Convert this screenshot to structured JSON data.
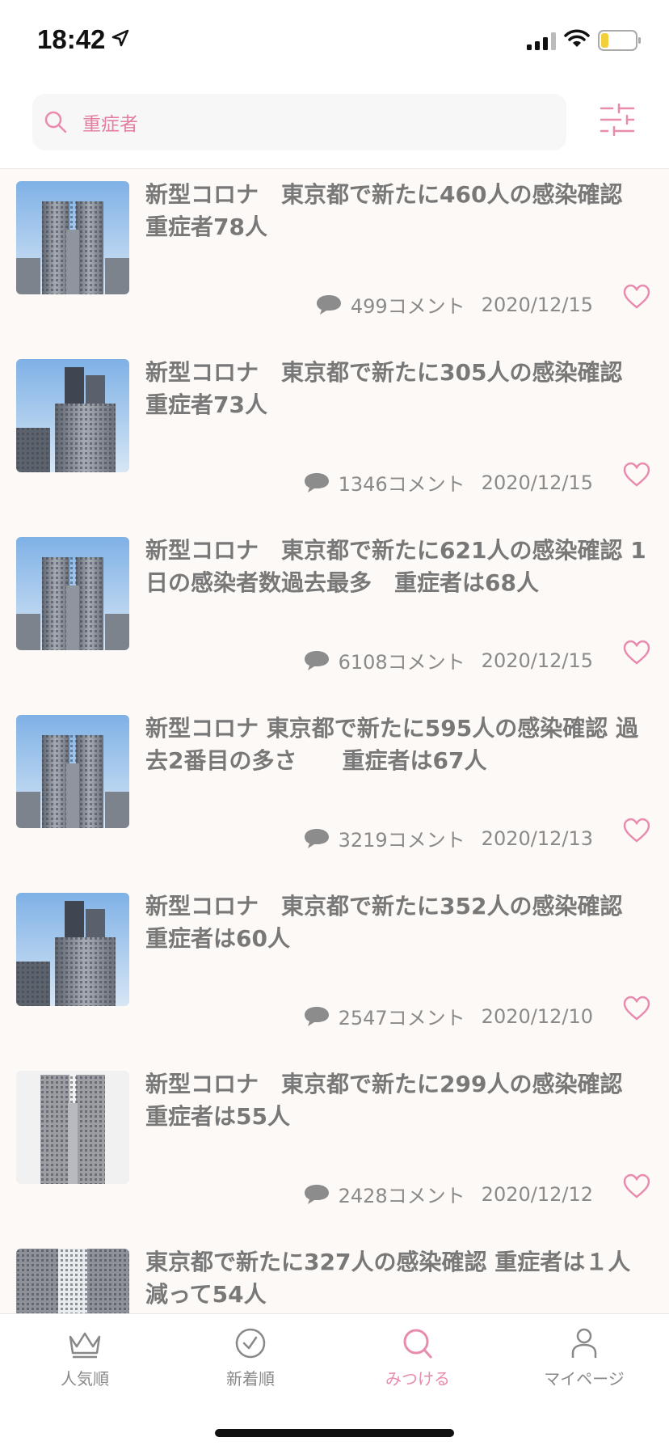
{
  "status_bar": {
    "time": "18:42"
  },
  "search": {
    "query": "重症者"
  },
  "articles": [
    {
      "title": "新型コロナ　東京都で新たに460人の感染確認 重症者78人",
      "comments": "499コメント",
      "date": "2020/12/15"
    },
    {
      "title": "新型コロナ　東京都で新たに305人の感染確認 重症者73人",
      "comments": "1346コメント",
      "date": "2020/12/15"
    },
    {
      "title": "新型コロナ　東京都で新たに621人の感染確認 1日の感染者数過去最多　重症者は68人",
      "comments": "6108コメント",
      "date": "2020/12/15"
    },
    {
      "title": "新型コロナ 東京都で新たに595人の感染確認 過去2番目の多さ　　重症者は67人",
      "comments": "3219コメント",
      "date": "2020/12/13"
    },
    {
      "title": "新型コロナ　東京都で新たに352人の感染確認 重症者は60人",
      "comments": "2547コメント",
      "date": "2020/12/10"
    },
    {
      "title": "新型コロナ　東京都で新たに299人の感染確認 重症者は55人",
      "comments": "2428コメント",
      "date": "2020/12/12"
    },
    {
      "title": "東京都で新たに327人の感染確認 重症者は１人減って54人",
      "comments": "",
      "date": ""
    }
  ],
  "tabs": [
    {
      "label": "人気順",
      "icon": "crown-icon"
    },
    {
      "label": "新着順",
      "icon": "clock-icon"
    },
    {
      "label": "みつける",
      "icon": "search-icon",
      "active": true
    },
    {
      "label": "マイページ",
      "icon": "person-icon"
    }
  ],
  "colors": {
    "accent": "#e98bae",
    "search_text": "#e37ea3",
    "list_bg": "#fdf9f6"
  }
}
